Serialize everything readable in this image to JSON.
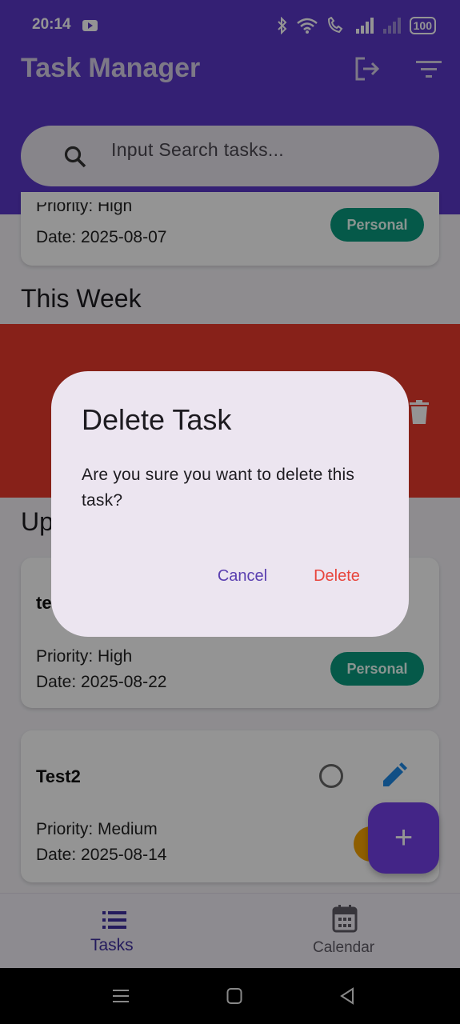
{
  "status_bar": {
    "time": "20:14",
    "battery": "100"
  },
  "app_bar": {
    "title": "Task Manager"
  },
  "search": {
    "placeholder": "Input Search tasks..."
  },
  "top_card": {
    "priority_partial": "Priority: High",
    "date": "Date: 2025-08-07",
    "tag": "Personal"
  },
  "sections": {
    "this_week": "This Week",
    "upcoming_partial": "Up"
  },
  "upcoming_cards": [
    {
      "name_partial": "te",
      "priority": "Priority: High",
      "date": "Date: 2025-08-22",
      "tag": "Personal"
    },
    {
      "name": "Test2",
      "priority": "Priority: Medium",
      "date": "Date: 2025-08-14"
    }
  ],
  "bottom_nav": {
    "tasks_label": "Tasks",
    "calendar_label": "Calendar"
  },
  "dialog": {
    "title": "Delete Task",
    "message": "Are you sure you want to delete this task?",
    "cancel_label": "Cancel",
    "delete_label": "Delete"
  },
  "colors": {
    "primary": "#5a37c8",
    "delete_red": "#e8453c",
    "chip_green": "#0a9a7e",
    "fab": "#7440e8"
  }
}
